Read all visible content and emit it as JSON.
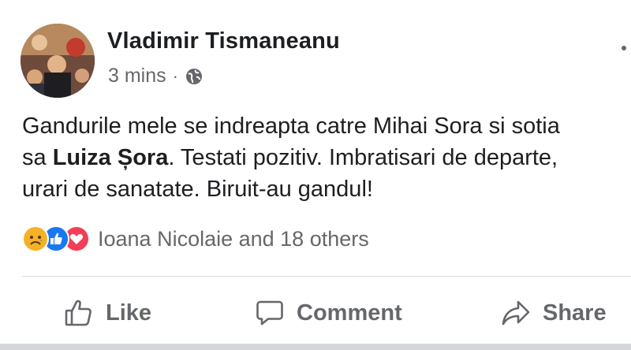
{
  "post": {
    "author": "Vladimir Tismaneanu",
    "timestamp": "3 mins",
    "separator": "·",
    "privacy_icon": "globe-icon",
    "more_icon": "more-dots-icon",
    "text": {
      "line1": "Gandurile mele se indreapta catre Mihai Sora si sotia",
      "line2_pre": "sa ",
      "line2_bold": "Luiza Șora",
      "line2_post": ". Testati pozitiv. Imbratisari de departe,",
      "line3": "urari de sanatate. Biruit-au gandul!"
    },
    "reactions": {
      "icons": [
        "sad-reaction-icon",
        "like-reaction-icon",
        "love-reaction-icon"
      ],
      "summary": "Ioana Nicolaie and 18 others"
    },
    "actions": {
      "like": "Like",
      "comment": "Comment",
      "share": "Share"
    }
  },
  "colors": {
    "text_primary": "#1c1e21",
    "text_secondary": "#65676b",
    "like_blue": "#1877f2",
    "love_red": "#f33e58",
    "sad_yellow": "#f7b125",
    "divider": "#dadde1"
  }
}
